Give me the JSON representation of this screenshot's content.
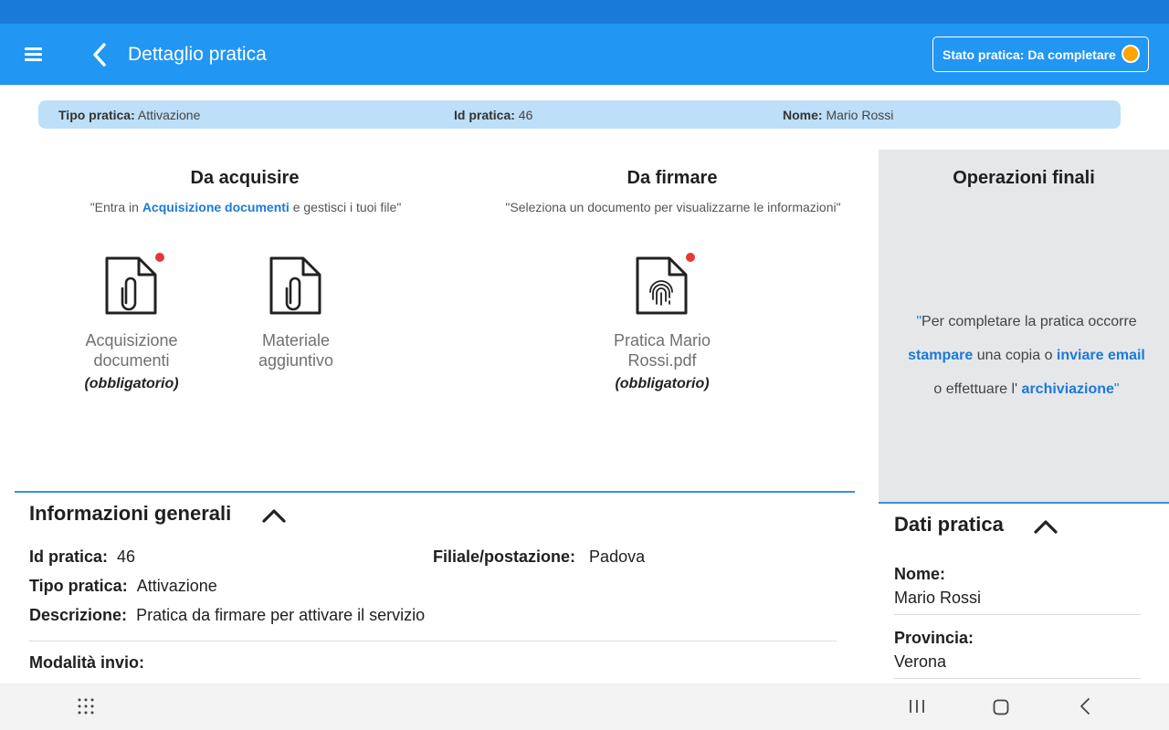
{
  "appbar": {
    "title": "Dettaglio pratica",
    "state_badge": "Stato pratica: Da completare",
    "state_color": "#ffa500",
    "primary_color": "#2196f3"
  },
  "info_bar": {
    "tipo_label": "Tipo pratica:",
    "tipo_value": "Attivazione",
    "id_label": "Id pratica:",
    "id_value": "46",
    "nome_label": "Nome:",
    "nome_value": "Mario Rossi"
  },
  "da_acquisire": {
    "title": "Da acquisire",
    "sub_pre": "\"Entra in ",
    "sub_link": "Acquisizione documenti",
    "sub_post": " e gestisci i tuoi file\"",
    "docs": [
      {
        "label": "Acquisizione documenti",
        "required": "(obbligatorio)",
        "icon": "clip-document-icon",
        "badge": true
      },
      {
        "label": "Materiale aggiuntivo",
        "required": "",
        "icon": "clip-document-icon",
        "badge": false
      }
    ]
  },
  "da_firmare": {
    "title": "Da firmare",
    "sub": "\"Seleziona un documento per visualizzarne le informazioni\"",
    "docs": [
      {
        "label": "Pratica Mario Rossi.pdf",
        "required": "(obbligatorio)",
        "icon": "fingerprint-document-icon",
        "badge": true
      }
    ]
  },
  "operazioni_finali": {
    "title": "Operazioni finali",
    "q_open": "\"",
    "line1": "Per completare la pratica occorre",
    "link_print": "stampare",
    "text_mid": " una copia o ",
    "link_email": "inviare email",
    "text_end": "o effettuare l' ",
    "link_archive": "archiviazione",
    "q_close": "\""
  },
  "info_generali": {
    "title": "Informazioni generali",
    "id_label": "Id pratica:",
    "id_value": "46",
    "filiale_label": "Filiale/postazione:",
    "filiale_value": "Padova",
    "tipo_label": "Tipo pratica:",
    "tipo_value": "Attivazione",
    "descr_label": "Descrizione:",
    "descr_value": "Pratica da firmare per attivare il servizio",
    "modalita_label": "Modalità invio:"
  },
  "dati_pratica": {
    "title": "Dati pratica",
    "nome_label": "Nome:",
    "nome_value": "Mario Rossi",
    "provincia_label": "Provincia:",
    "provincia_value": "Verona"
  },
  "navbar": {
    "buttons": [
      "apps-grid-icon",
      "recent-apps-icon",
      "home-icon",
      "back-icon"
    ]
  }
}
